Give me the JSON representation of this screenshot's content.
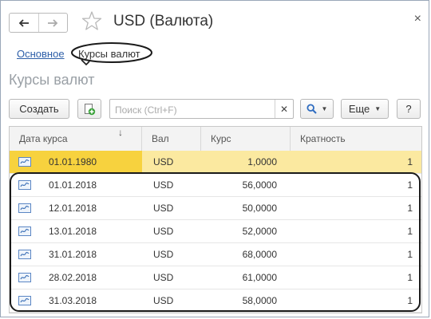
{
  "window": {
    "title": "USD (Валюта)"
  },
  "tabs": {
    "main": "Основное",
    "rates": "Курсы валют"
  },
  "section": {
    "title": "Курсы валют"
  },
  "toolbar": {
    "create_label": "Создать",
    "search_placeholder": "Поиск (Ctrl+F)",
    "more_label": "Еще",
    "help_label": "?"
  },
  "table": {
    "columns": [
      "Дата курса",
      "Вал",
      "Курс",
      "Кратность"
    ],
    "rows": [
      {
        "date": "01.01.1980",
        "currency": "USD",
        "rate": "1,0000",
        "multiplicity": "1"
      },
      {
        "date": "01.01.2018",
        "currency": "USD",
        "rate": "56,0000",
        "multiplicity": "1"
      },
      {
        "date": "12.01.2018",
        "currency": "USD",
        "rate": "50,0000",
        "multiplicity": "1"
      },
      {
        "date": "13.01.2018",
        "currency": "USD",
        "rate": "52,0000",
        "multiplicity": "1"
      },
      {
        "date": "31.01.2018",
        "currency": "USD",
        "rate": "68,0000",
        "multiplicity": "1"
      },
      {
        "date": "28.02.2018",
        "currency": "USD",
        "rate": "61,0000",
        "multiplicity": "1"
      },
      {
        "date": "31.03.2018",
        "currency": "USD",
        "rate": "58,0000",
        "multiplicity": "1"
      }
    ]
  },
  "colors": {
    "accent": "#f7d23e",
    "selected_row": "#fbe9a0",
    "link": "#2e5fa8"
  },
  "icons": [
    "back-arrow-icon",
    "forward-arrow-icon",
    "star-icon",
    "close-icon",
    "copy-add-icon",
    "search-icon",
    "record-icon"
  ]
}
